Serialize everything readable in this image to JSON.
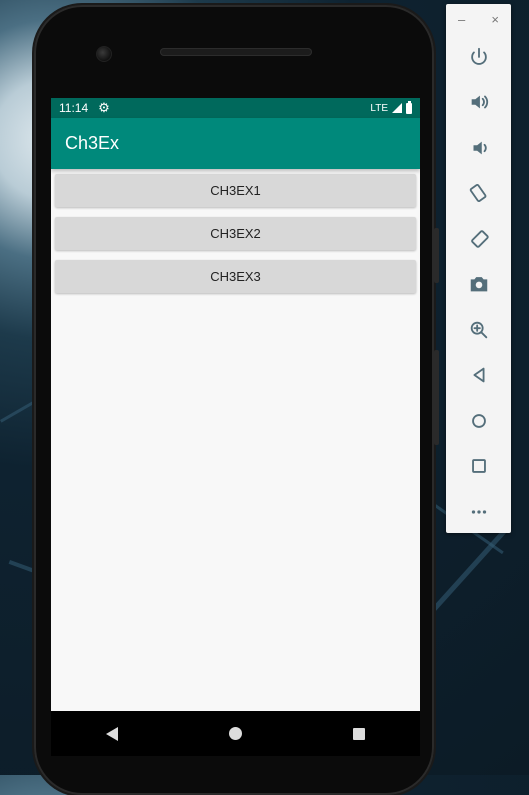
{
  "status_bar": {
    "time": "11:14",
    "network": "LTE"
  },
  "app_bar": {
    "title": "Ch3Ex"
  },
  "buttons": [
    "CH3EX1",
    "CH3EX2",
    "CH3EX3"
  ],
  "toolbar": {
    "minimize_glyph": "–",
    "close_glyph": "×",
    "items": [
      "power-icon",
      "volume-up-icon",
      "volume-down-icon",
      "rotate-left-icon",
      "rotate-right-icon",
      "camera-icon",
      "zoom-icon",
      "back-icon",
      "home-icon",
      "overview-icon",
      "more-icon"
    ]
  },
  "colors": {
    "status_bar": "#00695c",
    "app_bar": "#00897b",
    "button": "#d8d8d8",
    "screen_bg": "#f8f8f8"
  }
}
